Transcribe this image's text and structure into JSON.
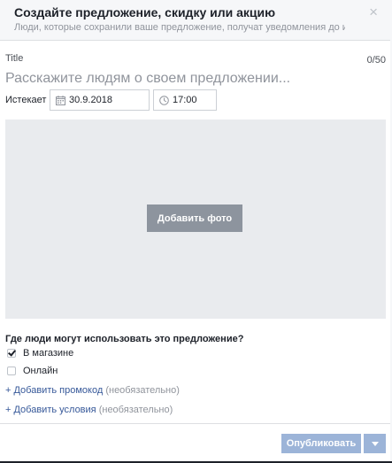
{
  "header": {
    "title": "Создайте предложение, скидку или акцию",
    "subtitle": "Люди, которые сохранили ваше предложение, получат уведомления до ис",
    "close_label": "×"
  },
  "form": {
    "title_label": "Title",
    "char_count": "0/50",
    "offer_placeholder": "Расскажите людям о своем предложении...",
    "offer_value": "",
    "expires_label": "Истекает",
    "date_value": "30.9.2018",
    "time_value": "17:00"
  },
  "photo": {
    "add_photo_label": "Добавить фото"
  },
  "availability": {
    "heading": "Где люди могут использовать это предложение?",
    "options": [
      {
        "label": "В магазине",
        "checked": true
      },
      {
        "label": "Онлайн",
        "checked": false
      }
    ]
  },
  "links": {
    "promo_link": "+ Добавить промокод",
    "promo_optional": "(необязательно)",
    "conditions_link": "+ Добавить условия",
    "conditions_optional": "(необязательно)"
  },
  "footer": {
    "publish_label": "Опубликовать"
  },
  "icons": {
    "calendar": "calendar-icon",
    "clock": "clock-icon",
    "dropdown": "chevron-down-icon",
    "close": "close-icon"
  },
  "colors": {
    "link": "#365899",
    "publish_disabled": "#9cb4d8",
    "photo_bg": "#e9ebee",
    "add_photo_btn": "#8d949e"
  }
}
